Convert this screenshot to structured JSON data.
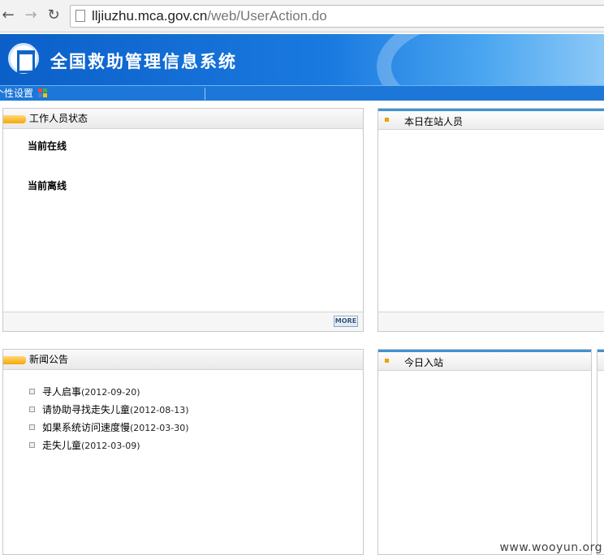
{
  "browser": {
    "url_domain": "lljiuzhu.mca.gov.cn",
    "url_path": "/web/UserAction.do"
  },
  "header": {
    "system_title": "全国救助管理信息系统"
  },
  "toolbar": {
    "settings_label": "个性设置",
    "settings_visible": "个性设置"
  },
  "panels": {
    "staff_status": {
      "title": "工作人员状态",
      "online_label": "当前在线",
      "offline_label": "当前离线",
      "more_label": "MORE"
    },
    "today_present": {
      "title": "本日在站人员"
    },
    "news": {
      "title": "新闻公告",
      "items": [
        {
          "title": "寻人启事",
          "date": "(2012-09-20)"
        },
        {
          "title": "请协助寻找走失儿童",
          "date": "(2012-08-13)"
        },
        {
          "title": "如果系统访问速度慢",
          "date": "(2012-03-30)"
        },
        {
          "title": "走失儿童",
          "date": "(2012-03-09)"
        }
      ]
    },
    "today_entry": {
      "title": "今日入站"
    }
  },
  "watermark": "www.wooyun.org",
  "colors": {
    "banner_blue": "#1a7ae0",
    "accent_orange": "#f7a800",
    "panel_blue_top": "#3f93d3"
  }
}
